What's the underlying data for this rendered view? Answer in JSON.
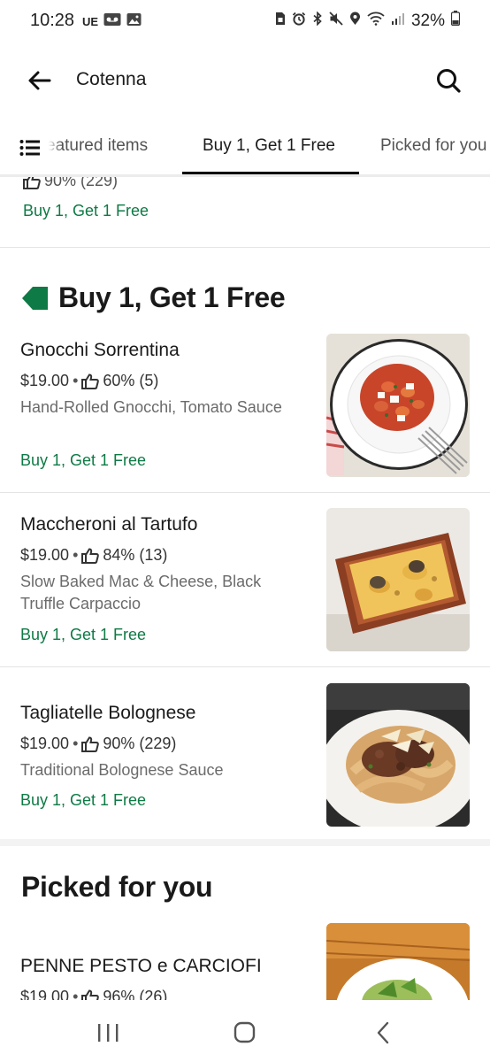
{
  "status_bar": {
    "time": "10:28",
    "carrier_label": "UE",
    "battery": "32%",
    "left_icons": [
      "carrier-ue-icon",
      "voicemail-icon",
      "gallery-icon"
    ],
    "right_icons": [
      "sim-icon",
      "alarm-icon",
      "bluetooth-icon",
      "mute-icon",
      "location-icon",
      "wifi-icon",
      "signal-icon",
      "battery-icon"
    ]
  },
  "header": {
    "title": "Cotenna",
    "back_icon": "arrow-left-icon",
    "search_icon": "search-icon"
  },
  "tabs": {
    "list_icon": "list-icon",
    "items": [
      {
        "label": "eatured items",
        "active": false
      },
      {
        "label": "Buy 1, Get 1 Free",
        "active": true
      },
      {
        "label": "Picked for you",
        "active": false
      }
    ]
  },
  "previous_item": {
    "rating": "90% (229)",
    "promo": "Buy 1, Get 1 Free"
  },
  "bogo_section": {
    "title": "Buy 1, Get 1 Free",
    "tag_icon": "tag-icon",
    "tag_color": "#0e7a45",
    "items": [
      {
        "name": "Gnocchi Sorrentina",
        "price": "$19.00",
        "separator": "•",
        "rating": "60% (5)",
        "description": "Hand-Rolled Gnocchi, Tomato Sauce",
        "promo": "Buy 1, Get 1 Free",
        "image": "gnocchi-plate-image"
      },
      {
        "name": "Maccheroni al Tartufo",
        "price": "$19.00",
        "separator": "•",
        "rating": "84% (13)",
        "description": "Slow Baked Mac & Cheese, Black Truffle Carpaccio",
        "promo": "Buy 1, Get 1 Free",
        "image": "mac-cheese-dish-image"
      },
      {
        "name": "Tagliatelle Bolognese",
        "price": "$19.00",
        "separator": "•",
        "rating": "90% (229)",
        "description": "Traditional Bolognese Sauce",
        "promo": "Buy 1, Get 1 Free",
        "image": "bolognese-plate-image"
      }
    ]
  },
  "picked_section": {
    "title": "Picked for you",
    "items": [
      {
        "name": "PENNE PESTO e CARCIOFI",
        "price": "$19.00",
        "separator": "•",
        "rating": "96% (26)",
        "image": "penne-pesto-image"
      }
    ]
  },
  "colors": {
    "promo_green": "#0e7a45",
    "text_primary": "#1a1a1a",
    "text_secondary": "#6b6b6b",
    "active_tab_underline": "#000000"
  },
  "nav_bar": {
    "icons": [
      "recents-icon",
      "home-icon",
      "back-icon"
    ]
  }
}
